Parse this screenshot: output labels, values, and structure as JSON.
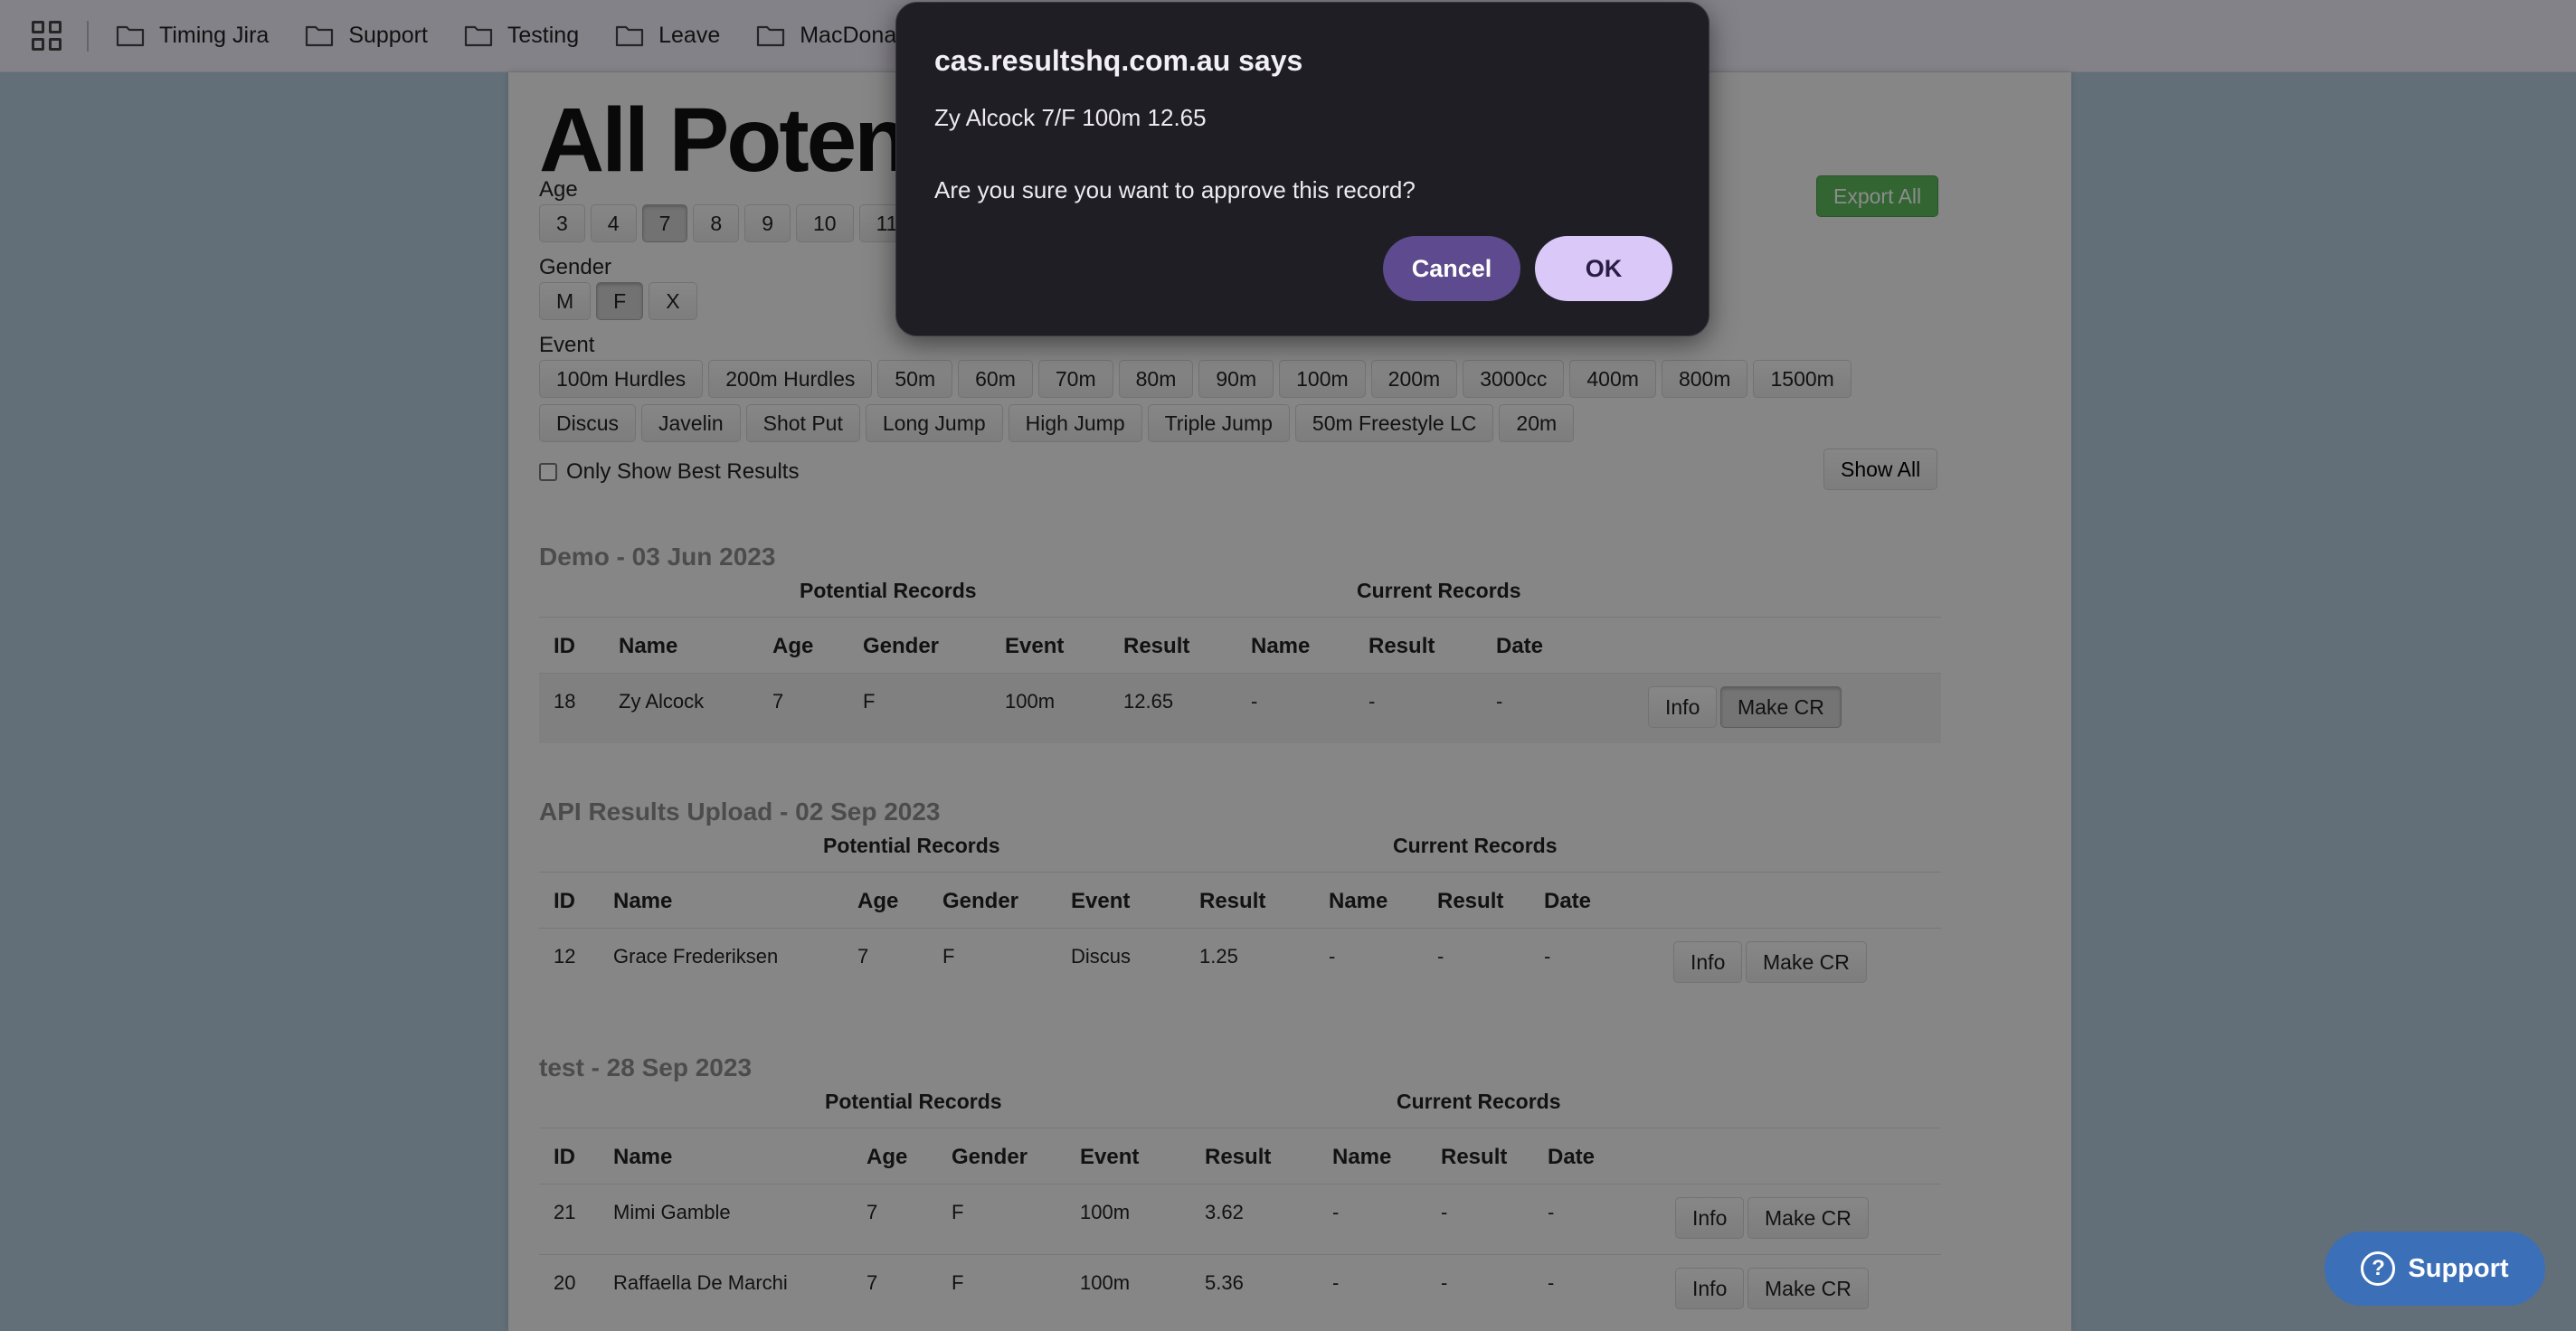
{
  "bookmarks": [
    "Timing Jira",
    "Support",
    "Testing",
    "Leave",
    "MacDonal"
  ],
  "page": {
    "title": "All Potential Records",
    "export_label": "Export All",
    "age_label": "Age",
    "ages": [
      "3",
      "4",
      "7",
      "8",
      "9",
      "10",
      "11"
    ],
    "selected_age": "7",
    "gender_label": "Gender",
    "genders": [
      "M",
      "F",
      "X"
    ],
    "selected_gender": "F",
    "event_label": "Event",
    "events_row1": [
      "100m Hurdles",
      "200m Hurdles",
      "50m",
      "60m",
      "70m",
      "80m",
      "90m",
      "100m",
      "200m",
      "3000cc",
      "400m",
      "800m",
      "1500m"
    ],
    "events_row2": [
      "Discus",
      "Javelin",
      "Shot Put",
      "Long Jump",
      "High Jump",
      "Triple Jump",
      "50m Freestyle LC",
      "20m"
    ],
    "only_best_label": "Only Show Best Results",
    "show_all_label": "Show All"
  },
  "table_headers": {
    "potential": "Potential Records",
    "current": "Current Records",
    "cols": [
      "ID",
      "Name",
      "Age",
      "Gender",
      "Event",
      "Result",
      "Name",
      "Result",
      "Date"
    ]
  },
  "sections": [
    {
      "title": "Demo - 03 Jun 2023",
      "rows": [
        {
          "id": "18",
          "name": "Zy Alcock",
          "age": "7",
          "gender": "F",
          "event": "100m",
          "result": "12.65",
          "cr_name": "-",
          "cr_result": "-",
          "cr_date": "-"
        }
      ]
    },
    {
      "title": "API Results Upload - 02 Sep 2023",
      "rows": [
        {
          "id": "12",
          "name": "Grace Frederiksen",
          "age": "7",
          "gender": "F",
          "event": "Discus",
          "result": "1.25",
          "cr_name": "-",
          "cr_result": "-",
          "cr_date": "-"
        }
      ]
    },
    {
      "title": "test - 28 Sep 2023",
      "rows": [
        {
          "id": "21",
          "name": "Mimi Gamble",
          "age": "7",
          "gender": "F",
          "event": "100m",
          "result": "3.62",
          "cr_name": "-",
          "cr_result": "-",
          "cr_date": "-"
        },
        {
          "id": "20",
          "name": "Raffaella De Marchi",
          "age": "7",
          "gender": "F",
          "event": "100m",
          "result": "5.36",
          "cr_name": "-",
          "cr_result": "-",
          "cr_date": "-"
        }
      ]
    }
  ],
  "row_buttons": {
    "info": "Info",
    "make_cr": "Make CR"
  },
  "dialog": {
    "title": "cas.resultshq.com.au says",
    "message": "Zy Alcock 7/F 100m 12.65",
    "question": "Are you sure you want to approve this record?",
    "cancel": "Cancel",
    "ok": "OK"
  },
  "support_label": "Support",
  "colors": {
    "dialog_bg": "#201e25",
    "ok_bg": "#d9c8f8",
    "cancel_bg": "#5e4a8e",
    "export_bg": "#5cb85c",
    "support_bg": "#3b6fb8"
  }
}
